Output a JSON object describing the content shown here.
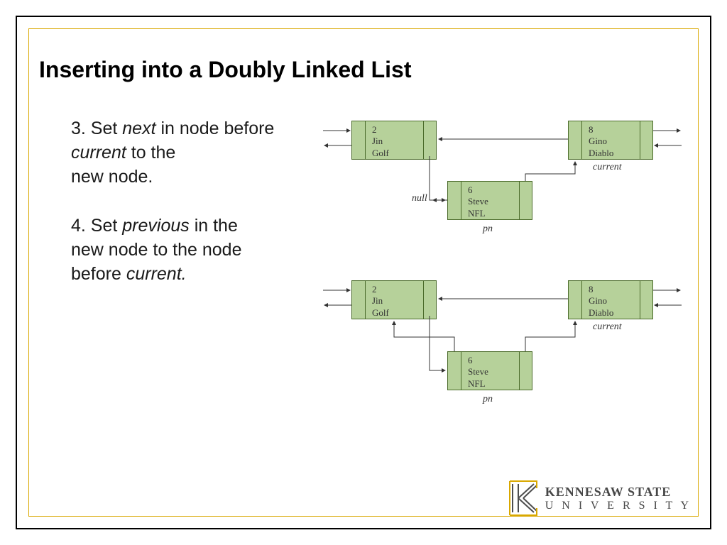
{
  "title": "Inserting into a Doubly Linked List",
  "step3": {
    "l1": "3. Set ",
    "i1": "next",
    "l2": " in node before ",
    "i2": "current",
    "l3": " to the",
    "l4": "new node."
  },
  "step4": {
    "l1": "4. Set ",
    "i1": "previous",
    "l2": " in the",
    "l3": "new node to the node",
    "l4": "before ",
    "i2": "current."
  },
  "nodes": {
    "a": {
      "id": "2",
      "name": "Jin",
      "data": "Golf"
    },
    "b": {
      "id": "6",
      "name": "Steve",
      "data": "NFL"
    },
    "c": {
      "id": "8",
      "name": "Gino",
      "data": "Diablo"
    }
  },
  "labels": {
    "null": "null",
    "pn": "pn",
    "current": "current"
  },
  "logo": {
    "line1": "KENNESAW STATE",
    "line2": "U N I V E R S I T Y"
  },
  "chart_data": {
    "type": "diagram",
    "title": "Inserting into a Doubly Linked List",
    "description": "Two states of a doubly linked list while inserting a new node (Steve) before current (Gino).",
    "states": [
      {
        "step": 3,
        "action": "Set next in node before current to the new node",
        "nodes": [
          {
            "ref": "a",
            "id": 2,
            "name": "Jin",
            "data": "Golf"
          },
          {
            "ref": "b",
            "id": 6,
            "name": "Steve",
            "data": "NFL",
            "label": "pn"
          },
          {
            "ref": "c",
            "id": 8,
            "name": "Gino",
            "data": "Diablo",
            "label": "current"
          }
        ],
        "links": [
          {
            "from": "a",
            "to": "b",
            "kind": "next"
          },
          {
            "from": "c",
            "to": "a",
            "kind": "previous"
          },
          {
            "from": "b",
            "to": "c",
            "kind": "next"
          },
          {
            "from": "b",
            "to": null,
            "kind": "previous"
          }
        ]
      },
      {
        "step": 4,
        "action": "Set previous in the new node to the node before current",
        "nodes": [
          {
            "ref": "a",
            "id": 2,
            "name": "Jin",
            "data": "Golf"
          },
          {
            "ref": "b",
            "id": 6,
            "name": "Steve",
            "data": "NFL",
            "label": "pn"
          },
          {
            "ref": "c",
            "id": 8,
            "name": "Gino",
            "data": "Diablo",
            "label": "current"
          }
        ],
        "links": [
          {
            "from": "a",
            "to": "b",
            "kind": "next"
          },
          {
            "from": "c",
            "to": "a",
            "kind": "previous"
          },
          {
            "from": "b",
            "to": "c",
            "kind": "next"
          },
          {
            "from": "b",
            "to": "a",
            "kind": "previous"
          }
        ]
      }
    ]
  }
}
